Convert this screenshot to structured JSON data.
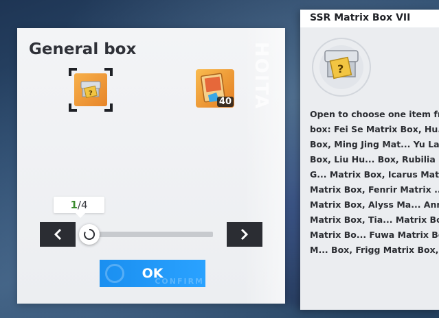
{
  "general_box": {
    "title": "General box",
    "deco_text": "HOITA",
    "reward_count": "40",
    "quantity": {
      "current": "1",
      "total": "/4"
    },
    "slider_level": 0.0,
    "ok_label": "OK",
    "ok_ghost": "CONFIRM"
  },
  "detail": {
    "title": "SSR Matrix Box VII",
    "description": "Open to choose one item from the box: Fei Se Matrix Box, Hu... Matrix Box, Ming Jing Mat... Yu Lan Matrix Box, Liu Hu... Box, Rubilia Matrix Box, G... Matrix Box, Icarus Matrix ... Matrix Box, Fenrir Matrix ... Umi Matrix Box, Alyss Ma... Annabella Matrix Box, Tia... Matrix Box, Lyra Matrix Bo... Fuwa Matrix Box, Ruby M... Box, Frigg Matrix Box, Ne..."
  },
  "colors": {
    "accent": "#1a8ff0",
    "count_green": "#3a8a2e",
    "item_orange": "#e7852a",
    "panel_bg": "#f3f4f6"
  },
  "icons": [
    "matrix-box-icon",
    "reward-item-icon",
    "chevron-left-icon",
    "chevron-right-icon",
    "slider-thumb-icon",
    "check-circle-icon"
  ]
}
